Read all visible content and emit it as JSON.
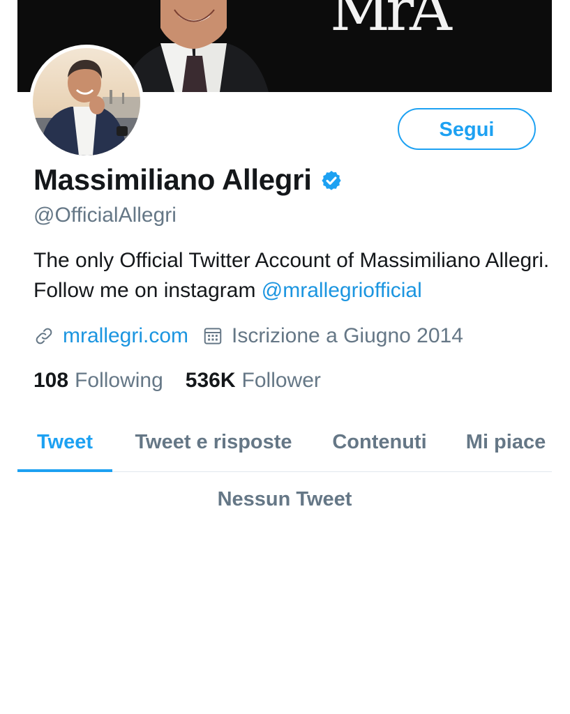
{
  "profile": {
    "banner_logo_text": "MrA",
    "display_name": "Massimiliano Allegri",
    "handle": "@OfficialAllegri",
    "bio_text": "The only Official Twitter Account of Massimiliano Allegri. Follow me on instagram ",
    "bio_mention": "@mrallegriofficial",
    "website": "mrallegri.com",
    "joined": "Iscrizione a Giugno 2014",
    "follow_label": "Segui",
    "verified": true
  },
  "stats": {
    "following_count": "108",
    "following_label": "Following",
    "followers_count": "536K",
    "followers_label": "Follower"
  },
  "tabs": [
    {
      "label": "Tweet",
      "active": true
    },
    {
      "label": "Tweet e risposte",
      "active": false
    },
    {
      "label": "Contenuti",
      "active": false
    },
    {
      "label": "Mi piace",
      "active": false
    }
  ],
  "feed": {
    "empty_message": "Nessun Tweet"
  },
  "colors": {
    "accent": "#1da1f2",
    "link": "#1b95e0",
    "text_primary": "#14171a",
    "text_secondary": "#657786",
    "banner_background": "#0c0c0c"
  },
  "icons": {
    "verified": "verified-badge-icon",
    "website": "link-icon",
    "joined": "calendar-icon"
  }
}
